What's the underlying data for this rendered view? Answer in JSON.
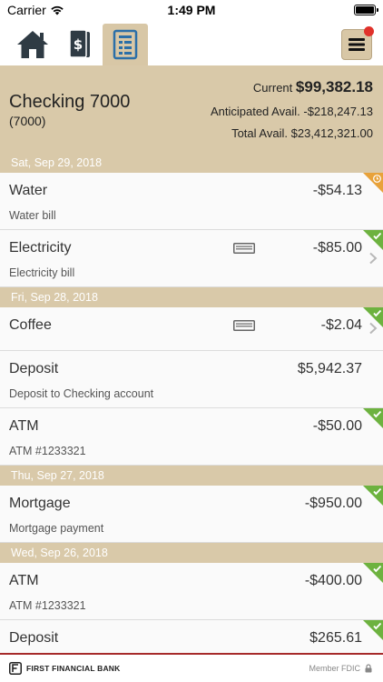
{
  "status_bar": {
    "carrier": "Carrier",
    "time": "1:49 PM"
  },
  "nav": {
    "tabs": [
      {
        "name": "home-tab",
        "icon": "home-icon"
      },
      {
        "name": "transfer-tab",
        "icon": "money-icon"
      },
      {
        "name": "statements-tab",
        "icon": "ledger-icon"
      }
    ],
    "active_tab": "statements-tab",
    "menu_icon": "hamburger-icon",
    "notification_color": "#e0312a"
  },
  "account": {
    "name": "Checking 7000",
    "number": "(7000)",
    "current_label": "Current",
    "current_value": "$99,382.18",
    "anticipated_label": "Anticipated Avail.",
    "anticipated_value": "-$218,247.13",
    "total_label": "Total Avail.",
    "total_value": "$23,412,321.00"
  },
  "colors": {
    "accent": "#d9c9a9",
    "cleared": "#6db23f",
    "pending": "#e8a23a",
    "brand_rule": "#a62a2a"
  },
  "groups": [
    {
      "date": "Sat, Sep 29, 2018",
      "transactions": [
        {
          "name": "Water",
          "amount": "-$54.13",
          "description": "Water bill",
          "status": "pending"
        },
        {
          "name": "Electricity",
          "amount": "-$85.00",
          "description": "Electricity bill",
          "status": "cleared"
        }
      ]
    },
    {
      "date": "Fri, Sep 28, 2018",
      "transactions": [
        {
          "name": "Coffee",
          "amount": "-$2.04",
          "description": "",
          "status": "cleared"
        },
        {
          "name": "Deposit",
          "amount": "$5,942.37",
          "description": "Deposit to Checking account",
          "status": "none"
        },
        {
          "name": "ATM",
          "amount": "-$50.00",
          "description": "ATM #1233321",
          "status": "cleared"
        }
      ]
    },
    {
      "date": "Thu, Sep 27, 2018",
      "transactions": [
        {
          "name": "Mortgage",
          "amount": "-$950.00",
          "description": "Mortgage payment",
          "status": "cleared"
        }
      ]
    },
    {
      "date": "Wed, Sep 26, 2018",
      "transactions": [
        {
          "name": "ATM",
          "amount": "-$400.00",
          "description": "ATM #1233321",
          "status": "cleared"
        },
        {
          "name": "Deposit",
          "amount": "$265.61",
          "description": "",
          "status": "cleared"
        }
      ]
    }
  ],
  "footer": {
    "bank_name": "FIRST FINANCIAL BANK",
    "fdic": "Member FDIC"
  }
}
